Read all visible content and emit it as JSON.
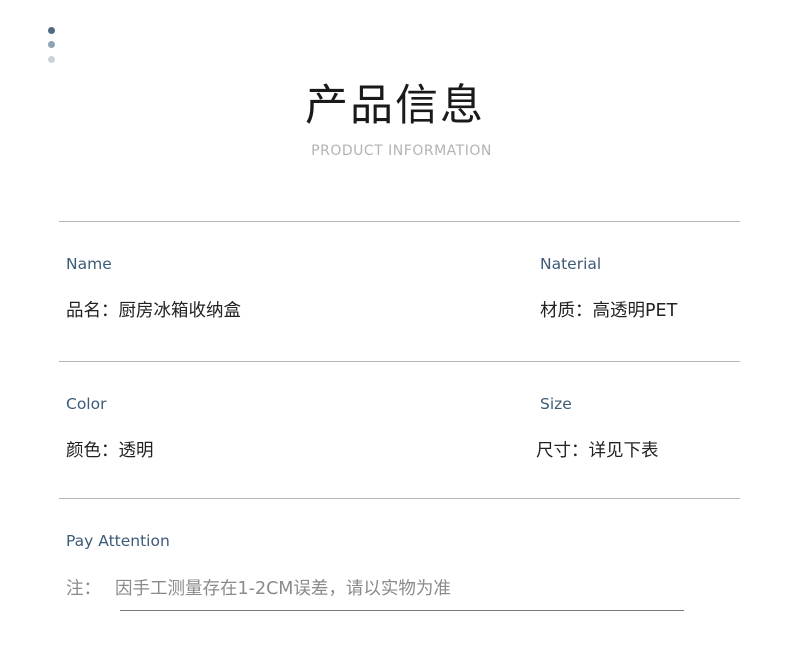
{
  "colors": {
    "dot1": "#4f6a80",
    "dot2": "#8ea3b3",
    "dot3": "#c9d3db",
    "label": "#3d5a78"
  },
  "header": {
    "title": "产品信息",
    "subtitle": "PRODUCT INFORMATION"
  },
  "fields": {
    "name": {
      "label": "Name",
      "value": "品名：厨房冰箱收纳盒"
    },
    "material": {
      "label": "Naterial",
      "value": "材质：高透明PET"
    },
    "color": {
      "label": "Color",
      "value": "颜色：透明"
    },
    "size": {
      "label": "Size",
      "value": "尺寸：详见下表"
    }
  },
  "attention": {
    "label": "Pay Attention",
    "prefix": "注：",
    "text": "因手工测量存在1-2CM误差，请以实物为准"
  }
}
